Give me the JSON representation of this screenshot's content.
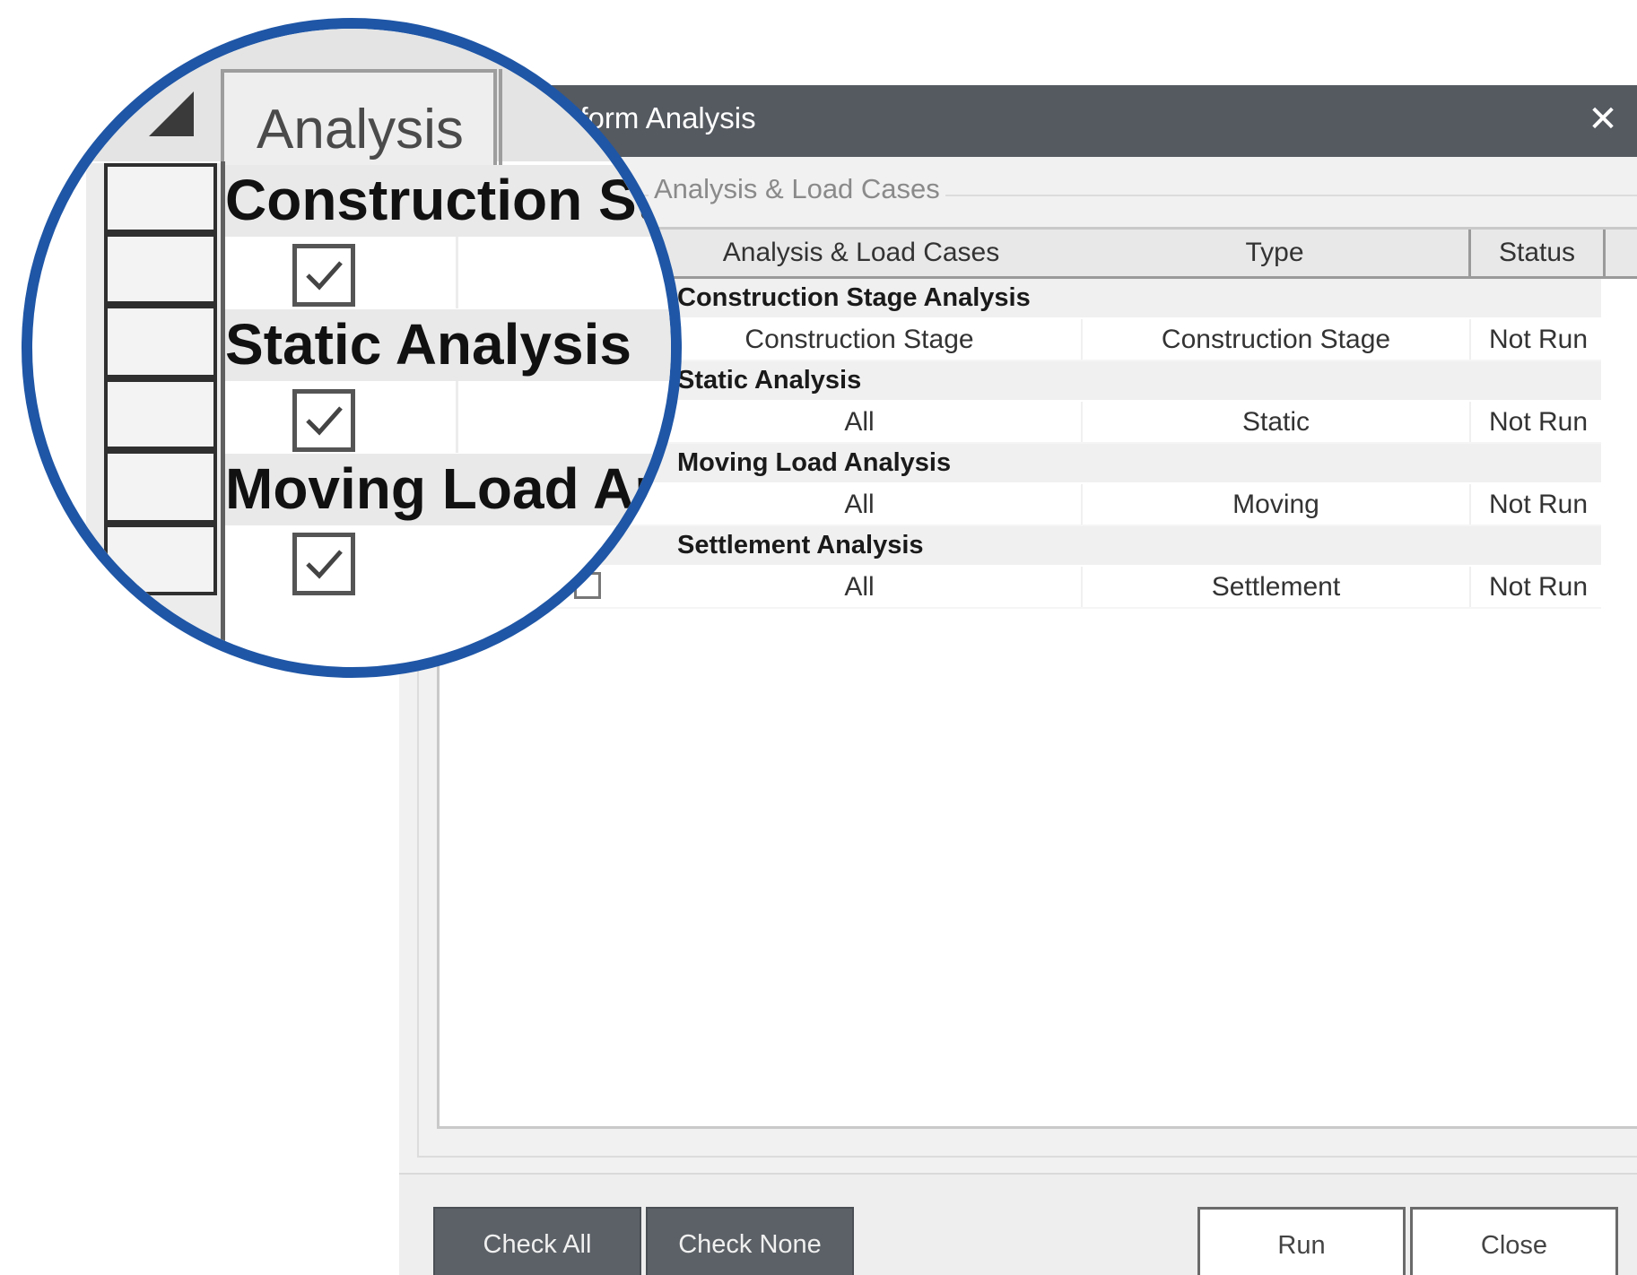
{
  "dialog": {
    "title": "Perform Analysis",
    "close_symbol": "✕",
    "group_label": "Analysis & Load Cases"
  },
  "table": {
    "columns": [
      "Analysis & Load Cases",
      "Type",
      "Status"
    ],
    "groups": [
      {
        "name": "Construction Stage Analysis",
        "rows": [
          {
            "case": "Construction Stage",
            "type": "Construction Stage",
            "status": "Not Run"
          }
        ]
      },
      {
        "name": "Static Analysis",
        "rows": [
          {
            "case": "All",
            "type": "Static",
            "status": "Not Run"
          }
        ]
      },
      {
        "name": "Moving Load Analysis",
        "rows": [
          {
            "case": "All",
            "type": "Moving",
            "status": "Not Run"
          }
        ]
      },
      {
        "name": "Settlement Analysis",
        "rows": [
          {
            "case": "All",
            "type": "Settlement",
            "status": "Not Run"
          }
        ]
      }
    ]
  },
  "buttons": {
    "check_all": "Check All",
    "check_none": "Check None",
    "run": "Run",
    "close": "Close"
  },
  "magnifier": {
    "tab_label": "Analysis",
    "groups": [
      "Construction Stage Analysis",
      "Static Analysis",
      "Moving Load Analysis"
    ],
    "checked": [
      true,
      true,
      true
    ],
    "ring_color": "#1f56a6"
  },
  "colors": {
    "titlebar": "#555a61",
    "dark_button": "#5c6167"
  }
}
